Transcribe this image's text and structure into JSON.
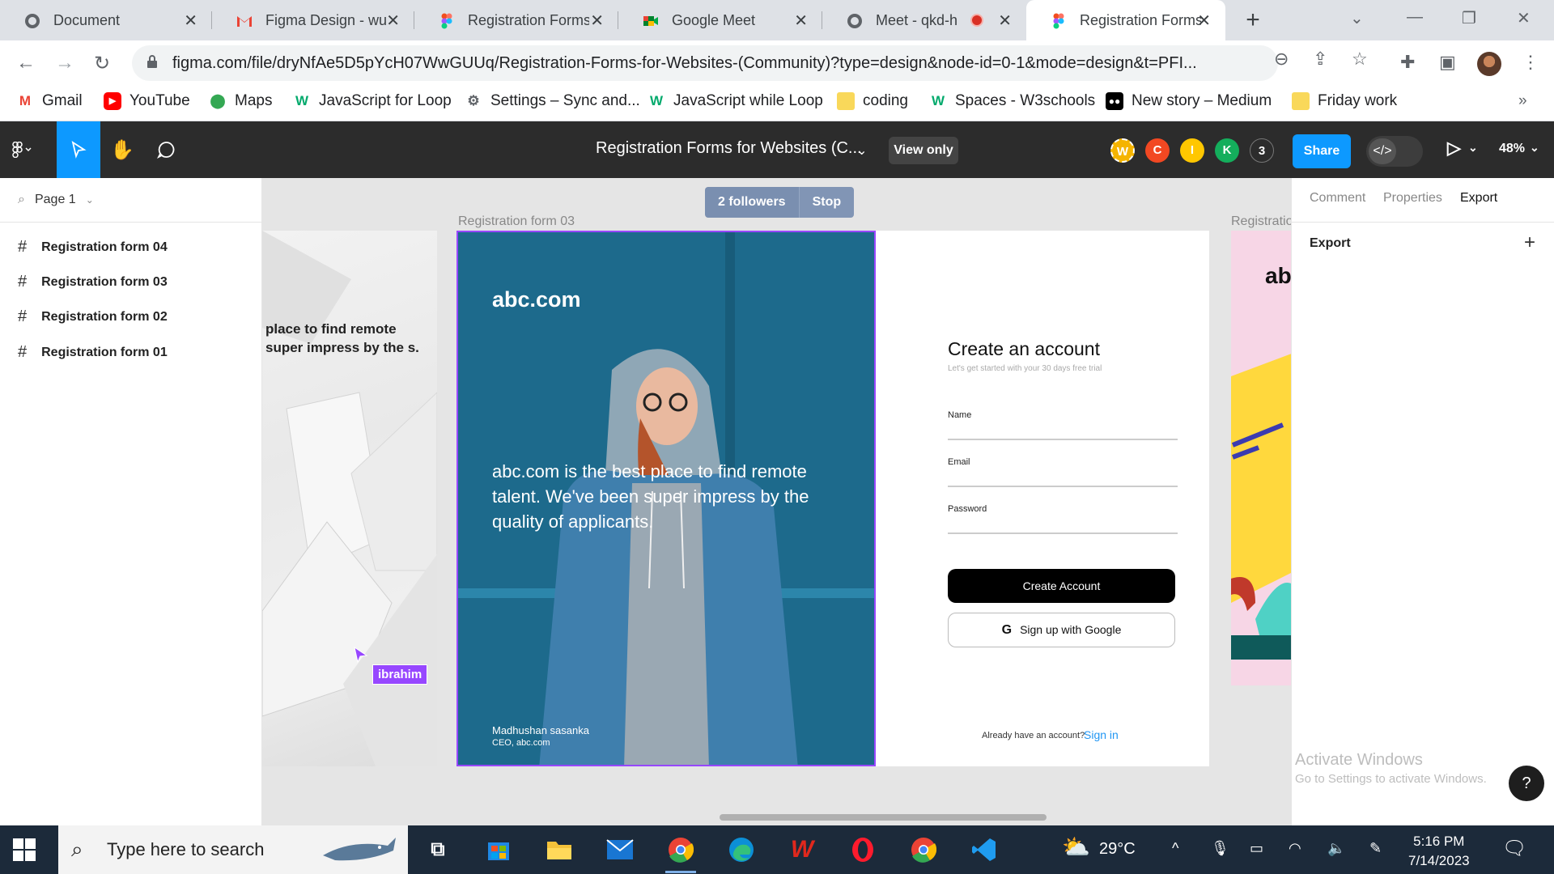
{
  "browser": {
    "tabs": [
      {
        "title": "Document",
        "active": false
      },
      {
        "title": "Figma Design - wu",
        "active": false
      },
      {
        "title": "Registration Forms",
        "active": false
      },
      {
        "title": "Google Meet",
        "active": false
      },
      {
        "title": "Meet - qkd-hy",
        "active": false
      },
      {
        "title": "Registration Forms",
        "active": true
      }
    ],
    "url": "figma.com/file/dryNfAe5D5pYcH07WwGUUq/Registration-Forms-for-Websites-(Community)?type=design&node-id=0-1&mode=design&t=PFI...",
    "bookmarks": [
      "Gmail",
      "YouTube",
      "Maps",
      "JavaScript for Loop",
      "Settings – Sync and...",
      "JavaScript while Loop",
      "coding",
      "Spaces - W3schools",
      "New story – Medium",
      "Friday work"
    ]
  },
  "figma": {
    "doc_title": "Registration Forms for Websites (C...",
    "view_only": "View only",
    "avatars": [
      {
        "letter": "W",
        "color": "#f5b400"
      },
      {
        "letter": "C",
        "color": "#f24822"
      },
      {
        "letter": "I",
        "color": "#ffc700"
      },
      {
        "letter": "K",
        "color": "#14ae5c"
      },
      {
        "letter": "3",
        "color": "#3a3a3a"
      }
    ],
    "share": "Share",
    "zoom": "48%",
    "page": "Page 1",
    "layers": [
      "Registration form 04",
      "Registration form 03",
      "Registration form 02",
      "Registration form 01"
    ],
    "right_tabs": [
      "Comment",
      "Properties",
      "Export"
    ],
    "export_label": "Export"
  },
  "canvas": {
    "followers": "2 followers",
    "stop": "Stop",
    "frame03_label": "Registration form 03",
    "frame02_label": "Registratio",
    "frame04_quote": "place to find remote super impress by the s.",
    "cursor_user": "ibrahim",
    "brand": "abc.com",
    "quote": "abc.com is the best place to find remote talent. We've been super impress by the quality of applicants.",
    "author": "Madhushan sasanka",
    "role": "CEO, abc.com",
    "form_title": "Create an account",
    "form_sub": "Let's get started with your 30 days free trial",
    "fields": [
      "Name",
      "Email",
      "Password"
    ],
    "create_btn": "Create Account",
    "google_btn": "Sign up with Google",
    "already": "Already have an account?",
    "signin": "Sign in",
    "frame02_text": "ab"
  },
  "watermark": {
    "line1": "Activate Windows",
    "line2": "Go to Settings to activate Windows."
  },
  "taskbar": {
    "search_placeholder": "Type here to search",
    "weather": "29°C",
    "time": "5:16 PM",
    "date": "7/14/2023"
  }
}
